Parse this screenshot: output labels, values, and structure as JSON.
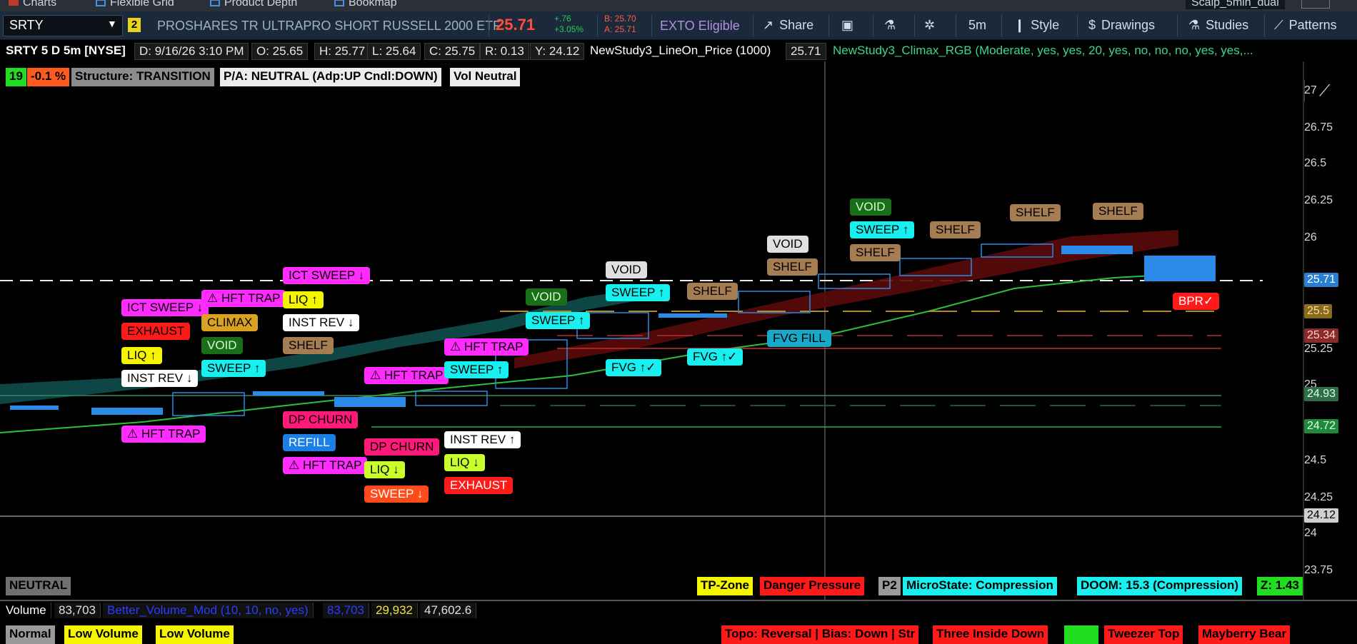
{
  "tabs": [
    {
      "label": "Charts",
      "color": "#c0392b"
    },
    {
      "label": "Flexible Grid",
      "color": "#4a90e2"
    },
    {
      "label": "Product Depth",
      "color": "#4a90e2"
    },
    {
      "label": "Bookmap",
      "color": "#4a90e2"
    }
  ],
  "layout_name": "Scalp_5min_dual",
  "toolbar": {
    "symbol": "SRTY",
    "link_number": "2",
    "description": "PROSHARES TR ULTRAPRO SHORT RUSSELL 2000 ETF",
    "last_price": "25.71",
    "change_abs": "+.76",
    "change_pct": "+3.05%",
    "bid": "B: 25.70",
    "ask": "A: 25.71",
    "exto": "EXTO Eligible",
    "share": "Share",
    "timeframe": "5m",
    "style": "Style",
    "drawings": "Drawings",
    "studies": "Studies",
    "patterns": "Patterns"
  },
  "infobar": {
    "title": "SRTY 5 D 5m [NYSE]",
    "date": "D: 9/16/26 3:10 PM",
    "open": "O: 25.65",
    "high": "H: 25.77",
    "low": "L: 25.64",
    "close": "C: 25.75",
    "range": "R: 0.13",
    "yest": "Y: 24.12",
    "study1": "NewStudy3_LineOn_Price (1000)",
    "study1_val": "25.71",
    "study2": "NewStudy3_Climax_RGB (Moderate, yes, yes, 20, yes, no, no, no, yes, yes,..."
  },
  "status_top": {
    "count": "19",
    "pct": "-0.1 %",
    "structure": "Structure: TRANSITION",
    "pa": "P/A: NEUTRAL  (Adp:UP  Cndl:DOWN)",
    "vol": "Vol Neutral"
  },
  "price_axis": [
    "27",
    "26.75",
    "26.5",
    "26.25",
    "26",
    "25.25",
    "25",
    "24.5",
    "24.25",
    "24",
    "23.75"
  ],
  "price_tags": [
    {
      "value": "25.71",
      "bg": "#2a7fd4",
      "fg": "#ffffff"
    },
    {
      "value": "25.5",
      "bg": "#8a6a1c",
      "fg": "#f0e0a0"
    },
    {
      "value": "25.34",
      "bg": "#8a2a2a",
      "fg": "#ffd0d0"
    },
    {
      "value": "24.93",
      "bg": "#2f6e46",
      "fg": "#d9ffe6"
    },
    {
      "value": "24.72",
      "bg": "#1f8a3a",
      "fg": "#e0ffe0"
    },
    {
      "value": "24.12",
      "bg": "#d0d0d0",
      "fg": "#000000"
    }
  ],
  "labels": {
    "l1": "ICT SWEEP ↓",
    "l2": "⚠ HFT TRAP",
    "l3": "EXHAUST",
    "l4": "CLIMAX",
    "l5": "LIQ ↑",
    "l6": "VOID",
    "l7": "INST REV ↓",
    "l8": "SWEEP ↑",
    "l9": "⚠ HFT TRAP",
    "l10": "ICT SWEEP ↓",
    "l11": "LIQ ↑",
    "l12": "INST REV ↓",
    "l13": "SHELF",
    "l14": "DP CHURN",
    "l15": "REFILL",
    "l16": "⚠ HFT TRAP",
    "l17": "⚠ HFT TRAP",
    "l18": "DP CHURN",
    "l19": "LIQ ↓",
    "l20": "SWEEP ↓",
    "l21": "⚠ HFT TRAP",
    "l22": "SWEEP ↑",
    "l23": "INST REV ↑",
    "l24": "LIQ ↓",
    "l25": "EXHAUST",
    "l26": "VOID",
    "l27": "SWEEP ↑",
    "l28": "VOID",
    "l29": "SWEEP ↑",
    "l30": "FVG ↑✓",
    "l31": "SHELF",
    "l32": "FVG ↑✓",
    "l33": "VOID",
    "l34": "SHELF",
    "l35": "FVG FILL",
    "l36": "VOID",
    "l37": "SWEEP ↑",
    "l38": "SHELF",
    "l39": "SHELF",
    "l40": "SHELF",
    "l41": "SHELF",
    "l42": "BPR✓"
  },
  "status_bottom": {
    "neutral": "NEUTRAL",
    "tpzone": "TP-Zone",
    "danger": "Danger Pressure",
    "p2": "P2",
    "microstate": "MicroState: Compression",
    "doom": "DOOM: 15.3 (Compression)",
    "z": "Z: 1.43"
  },
  "volume_bar": {
    "label": "Volume",
    "v1": "83,703",
    "study": "Better_Volume_Mod (10, 10, no, yes)",
    "v2": "83,703",
    "v3": "29,932",
    "v4": "47,602.6"
  },
  "volume_tags": {
    "normal": "Normal",
    "low1": "Low Volume",
    "low2": "Low Volume",
    "r1": "Topo: Reversal | Bias: Down | Str",
    "r2": "Three Inside Down",
    "r3": "Tweezer Top",
    "r4": "Mayberry Bear"
  }
}
